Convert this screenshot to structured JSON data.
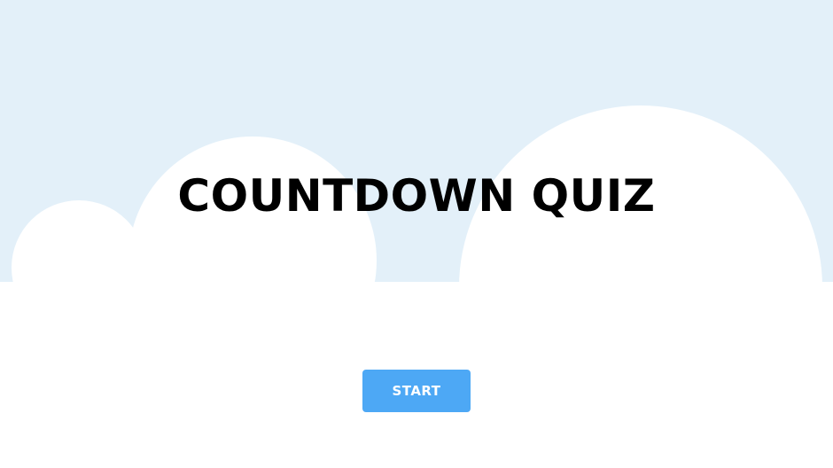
{
  "title": "COUNTDOWN QUIZ",
  "start_button": {
    "label": "START"
  },
  "colors": {
    "sky": "#e3f0f9",
    "cloud": "#ffffff",
    "title": "#000000",
    "button_bg": "#4da8f5",
    "button_text": "#ffffff"
  }
}
